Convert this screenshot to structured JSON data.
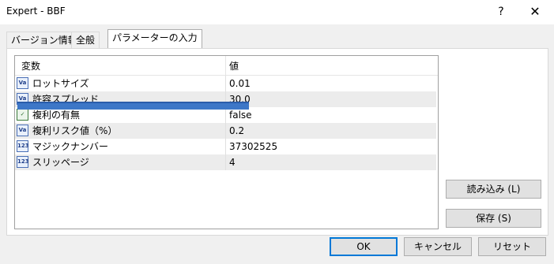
{
  "window": {
    "title": "Expert - BBF",
    "help_glyph": "?",
    "close_glyph": "✕"
  },
  "tabs": [
    {
      "label": "バージョン情報"
    },
    {
      "label": "全般"
    },
    {
      "label": "パラメーターの入力",
      "active": true
    }
  ],
  "table": {
    "col_name": "変数",
    "col_value": "値",
    "rows": [
      {
        "icon": "number-param-icon",
        "icon_text": "Va",
        "name": "ロットサイズ",
        "value": "0.01"
      },
      {
        "icon": "number-param-icon",
        "icon_text": "Va",
        "name": "許容スプレッド",
        "value": "30.0"
      },
      {
        "icon": "boolean-param-icon",
        "icon_text": "✓",
        "name": "複利の有無",
        "value": "false"
      },
      {
        "icon": "number-param-icon",
        "icon_text": "Va",
        "name": "複利リスク値（%）",
        "value": "0.2"
      },
      {
        "icon": "integer-param-icon",
        "icon_text": "123",
        "name": "マジックナンバー",
        "value": "37302525"
      },
      {
        "icon": "integer-param-icon",
        "icon_text": "123",
        "name": "スリッページ",
        "value": "4"
      }
    ]
  },
  "side_buttons": {
    "load": "読み込み (L)",
    "save": "保存 (S)"
  },
  "footer_buttons": {
    "ok": "OK",
    "cancel": "キャンセル",
    "reset": "リセット"
  },
  "colors": {
    "accent": "#0078d7",
    "drag_highlight": "#3d77c7"
  }
}
